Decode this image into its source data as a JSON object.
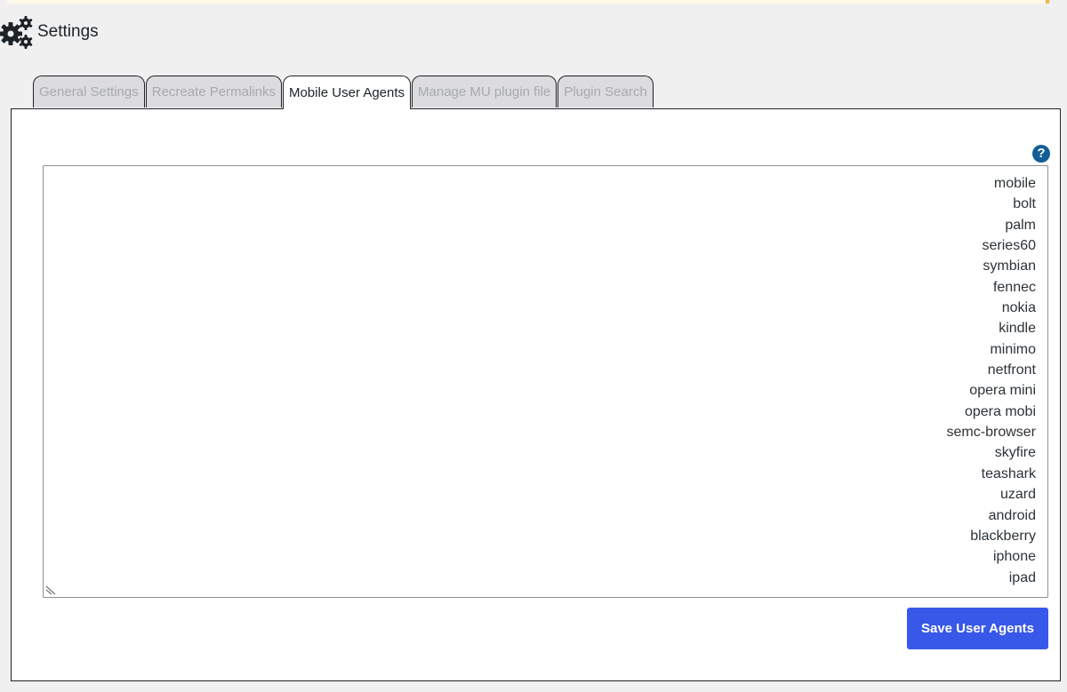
{
  "header": {
    "title": "Settings",
    "icon": "gears-icon"
  },
  "tabs": [
    {
      "label": "General Settings",
      "active": false
    },
    {
      "label": "Recreate Permalinks",
      "active": false
    },
    {
      "label": "Mobile User Agents",
      "active": true
    },
    {
      "label": "Manage MU plugin file",
      "active": false
    },
    {
      "label": "Plugin Search",
      "active": false
    }
  ],
  "user_agents": {
    "help_icon": "help-icon",
    "help_symbol": "?",
    "lines": [
      "mobile",
      "bolt",
      "palm",
      "series60",
      "symbian",
      "fennec",
      "nokia",
      "kindle",
      "minimo",
      "netfront",
      "opera mini",
      "opera mobi",
      "semc-browser",
      "skyfire",
      "teashark",
      "uzard",
      "android",
      "blackberry",
      "iphone",
      "ipad"
    ],
    "save_label": "Save User Agents"
  },
  "colors": {
    "accent": "#3858e9",
    "help": "#135e96",
    "background": "#f0f0f1"
  }
}
